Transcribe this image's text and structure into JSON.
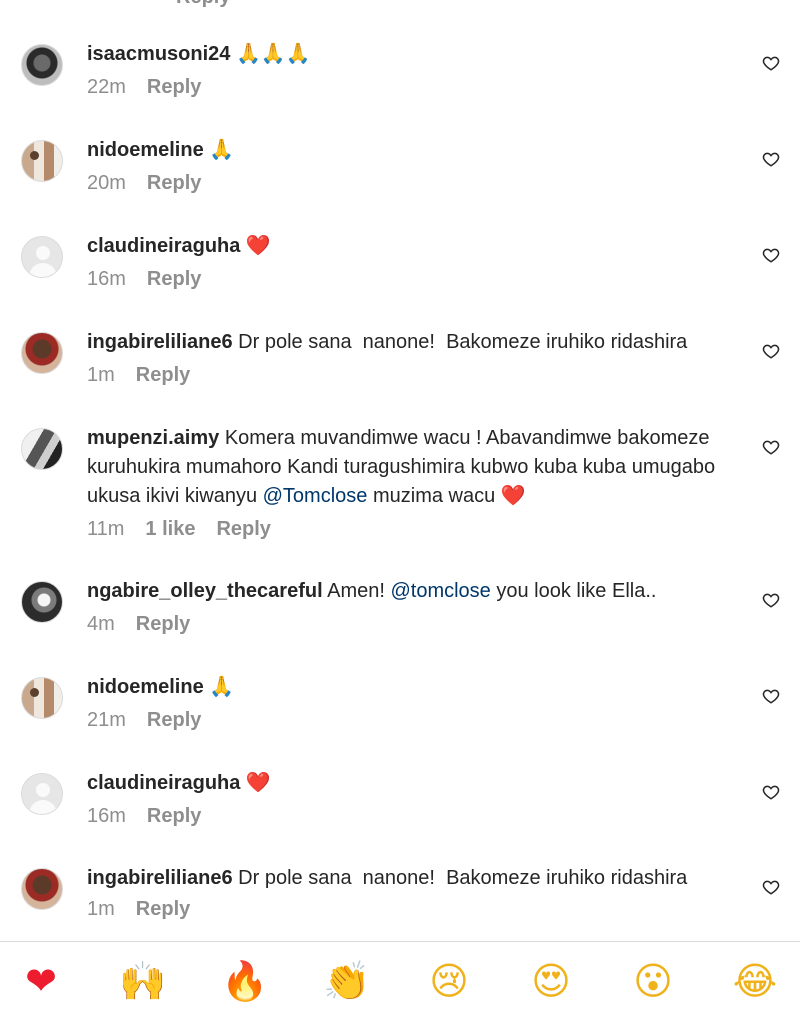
{
  "top_cut_reply": "Reply",
  "comments": [
    {
      "username": "isaacmusoni24",
      "text": " 🙏🙏🙏",
      "mention": "",
      "text_after": "",
      "time": "22m",
      "likes": "",
      "reply": "Reply",
      "avatar": "dark-avatar"
    },
    {
      "username": "nidoemeline",
      "text": " 🙏",
      "mention": "",
      "text_after": "",
      "time": "20m",
      "likes": "",
      "reply": "Reply",
      "avatar": "photo-avatar"
    },
    {
      "username": "claudineiraguha",
      "text": " ❤️",
      "mention": "",
      "text_after": "",
      "time": "16m",
      "likes": "",
      "reply": "Reply",
      "avatar": "default-avatar"
    },
    {
      "username": "ingabireliliane6",
      "text": " Dr pole sana  nanone!  Bakomeze iruhiko ridashira",
      "mention": "",
      "text_after": "",
      "time": "1m",
      "likes": "",
      "reply": "Reply",
      "avatar": "photo-avatar"
    },
    {
      "username": "mupenzi.aimy",
      "text": " Komera muvandimwe wacu ! Abavandimwe bakomeze kuruhukira mumahoro Kandi turagushimira kubwo kuba kuba umugabo ukusa ikivi kiwanyu ",
      "mention": "@Tomclose",
      "text_after": " muzima wacu ❤️",
      "time": "11m",
      "likes": "1 like",
      "reply": "Reply",
      "avatar": "photo-avatar"
    },
    {
      "username": "ngabire_olley_thecareful",
      "text": " Amen! ",
      "mention": "@tomclose",
      "text_after": " you look like Ella..",
      "time": "4m",
      "likes": "",
      "reply": "Reply",
      "avatar": "photo-avatar"
    },
    {
      "username": "nidoemeline",
      "text": " 🙏",
      "mention": "",
      "text_after": "",
      "time": "21m",
      "likes": "",
      "reply": "Reply",
      "avatar": "photo-avatar"
    },
    {
      "username": "claudineiraguha",
      "text": " ❤️",
      "mention": "",
      "text_after": "",
      "time": "16m",
      "likes": "",
      "reply": "Reply",
      "avatar": "default-avatar"
    },
    {
      "username": "ingabireliliane6",
      "text": " Dr pole sana  nanone!  Bakomeze iruhiko ridashira",
      "mention": "",
      "text_after": "",
      "time": "1m",
      "likes": "",
      "reply": "Reply",
      "avatar": "photo-avatar"
    }
  ],
  "reactions": [
    "❤",
    "🙌",
    "🔥",
    "👏",
    "😢",
    "😍",
    "😮",
    "😂"
  ],
  "icons": {
    "like": "heart-outline-icon"
  },
  "colors": {
    "mention": "#00376b",
    "meta": "#8e8e8e",
    "text": "#262626"
  }
}
